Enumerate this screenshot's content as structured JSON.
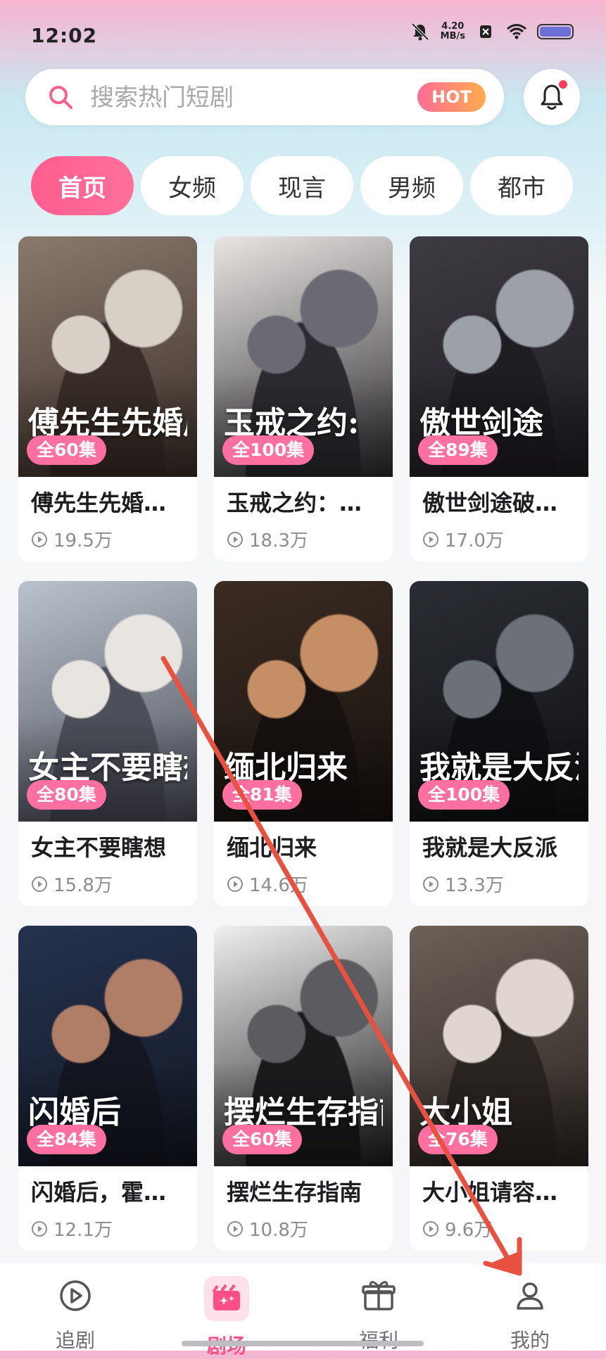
{
  "status_bar": {
    "time": "12:02",
    "net_speed_value": "4.20",
    "net_speed_unit": "MB/s"
  },
  "search": {
    "placeholder": "搜索热门短剧",
    "hot_label": "HOT"
  },
  "tabs": [
    "首页",
    "女频",
    "现言",
    "男频",
    "都市"
  ],
  "active_tab": "首页",
  "dramas": [
    {
      "title": "傅先生先婚…",
      "poster_text": "傅先生先婚后爱",
      "episodes": "全60集",
      "views": "19.5万",
      "palette": [
        "#8a7a6e",
        "#d8d0c6",
        "#3a2e28"
      ]
    },
    {
      "title": "玉戒之约：…",
      "poster_text": "玉戒之约:",
      "episodes": "全100集",
      "views": "18.3万",
      "palette": [
        "#e9e5e2",
        "#6b6a73",
        "#2c2b31"
      ]
    },
    {
      "title": "傲世剑途破…",
      "poster_text": "傲世剑途",
      "episodes": "全89集",
      "views": "17.0万",
      "palette": [
        "#3d3c42",
        "#9da0a8",
        "#1f1c22"
      ]
    },
    {
      "title": "女主不要瞎想",
      "poster_text": "女主不要瞎想",
      "episodes": "全80集",
      "views": "15.8万",
      "palette": [
        "#b9c2cc",
        "#e8e4e0",
        "#4d4f5a"
      ]
    },
    {
      "title": "缅北归来",
      "poster_text": "缅北归来",
      "episodes": "全81集",
      "views": "14.6万",
      "palette": [
        "#3b2c22",
        "#c68e64",
        "#171210"
      ]
    },
    {
      "title": "我就是大反派",
      "poster_text": "我就是大反派",
      "episodes": "全100集",
      "views": "13.3万",
      "palette": [
        "#2a2d33",
        "#6b7079",
        "#101114"
      ]
    },
    {
      "title": "闪婚后，霍…",
      "poster_text": "闪婚后",
      "episodes": "全84集",
      "views": "12.1万",
      "palette": [
        "#243350",
        "#b07d66",
        "#141722"
      ]
    },
    {
      "title": "摆烂生存指南",
      "poster_text": "摆烂生存指南",
      "episodes": "全60集",
      "views": "10.8万",
      "palette": [
        "#efefef",
        "#5c5c60",
        "#1b1b1d"
      ]
    },
    {
      "title": "大小姐请容…",
      "poster_text": "大小姐",
      "episodes": "全76集",
      "views": "9.6万",
      "palette": [
        "#6d6058",
        "#e0d6cf",
        "#2b2522"
      ]
    }
  ],
  "nav": [
    {
      "label": "追剧",
      "icon": "play-circle-icon"
    },
    {
      "label": "剧场",
      "icon": "theater-icon"
    },
    {
      "label": "福利",
      "icon": "gift-icon"
    },
    {
      "label": "我的",
      "icon": "profile-icon"
    }
  ],
  "active_nav": "剧场",
  "colors": {
    "accent": "#ff5e8e",
    "arrow": "#e8503f"
  }
}
